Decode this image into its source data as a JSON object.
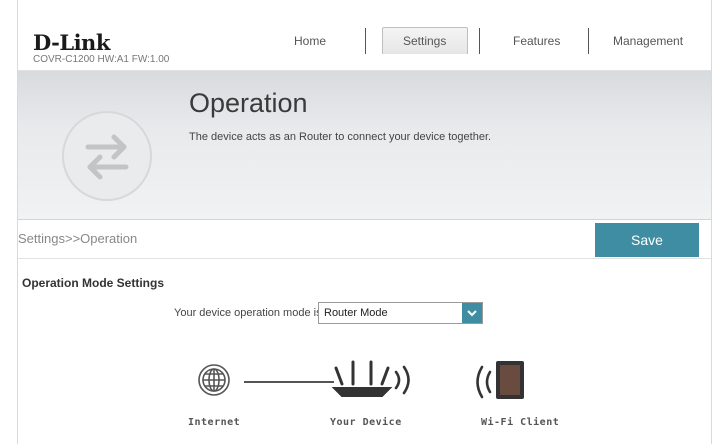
{
  "header": {
    "logo": "D-Link",
    "model": "COVR-C1200 HW:A1 FW:1.00",
    "nav": [
      {
        "label": "Home"
      },
      {
        "label": "Settings"
      },
      {
        "label": "Features"
      },
      {
        "label": "Management"
      }
    ],
    "active_nav": "Settings"
  },
  "banner": {
    "title": "Operation",
    "description": "The device acts as an Router to connect your device together.",
    "icon": "swap-arrows-icon"
  },
  "breadcrumb": "Settings>>Operation",
  "save_label": "Save",
  "section": {
    "title": "Operation Mode Settings",
    "mode_label": "Your device operation mode is:",
    "mode_value": "Router Mode"
  },
  "diagram": {
    "internet_label": "Internet",
    "device_label": "Your Device",
    "client_label": "Wi-Fi Client"
  },
  "colors": {
    "accent": "#3e8da3"
  }
}
